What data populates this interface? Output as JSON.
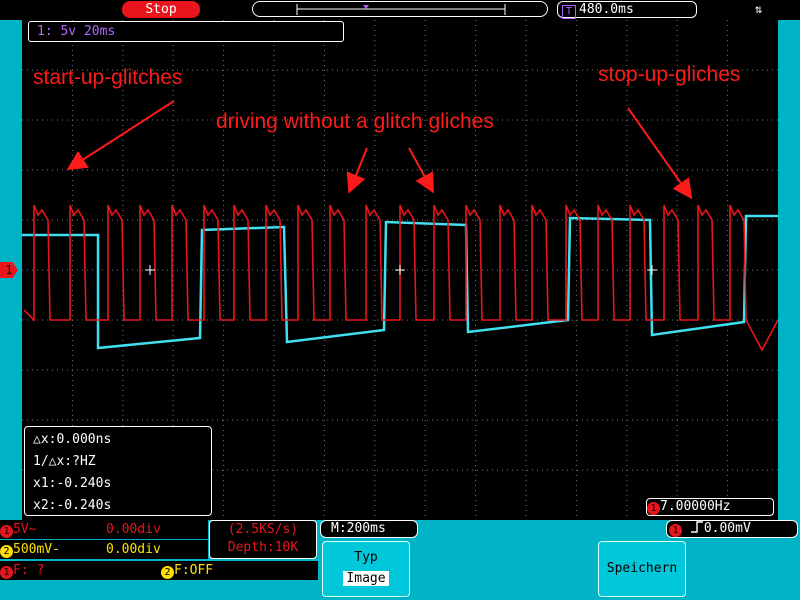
{
  "header": {
    "status": "Stop",
    "timebase_icon": "T",
    "time_offset": "480.0ms",
    "usb_icon": "usb-icon"
  },
  "channel_info": "1: 5v 20ms",
  "ch1_marker": "1",
  "annotations": {
    "start": "start-up-glitches",
    "driving": "driving without a glitch gliches",
    "stop": "stop-up-gliches"
  },
  "cursor": {
    "dx": "△x:0.000ns",
    "inv_dx": "1/△x:?HZ",
    "x1": "x1:-0.240s",
    "x2": "x2:-0.240s"
  },
  "frequency": {
    "num": "1",
    "value": "7.00000Hz"
  },
  "channels": {
    "ch1": {
      "num": "1",
      "scale": "5V~",
      "offset": "0.00div"
    },
    "ch2": {
      "num": "2",
      "scale": "500mV-",
      "offset": "0.00div"
    },
    "f1": {
      "num": "1",
      "label": "F:  ?"
    },
    "f2": {
      "num": "2",
      "label": "F:OFF"
    }
  },
  "acquisition": {
    "rate": "(2.5KS/s)",
    "depth": "Depth:10K"
  },
  "timebase": "M:200ms",
  "trigger": {
    "num": "1",
    "level": "0.00mV"
  },
  "softkeys": {
    "type_label": "Typ",
    "type_value": "Image",
    "save_label": "Speichern"
  },
  "colors": {
    "ch1": "#e8161c",
    "ch2": "#40e0f0",
    "frame": "#00b4c6",
    "math": "#b266ff"
  }
}
